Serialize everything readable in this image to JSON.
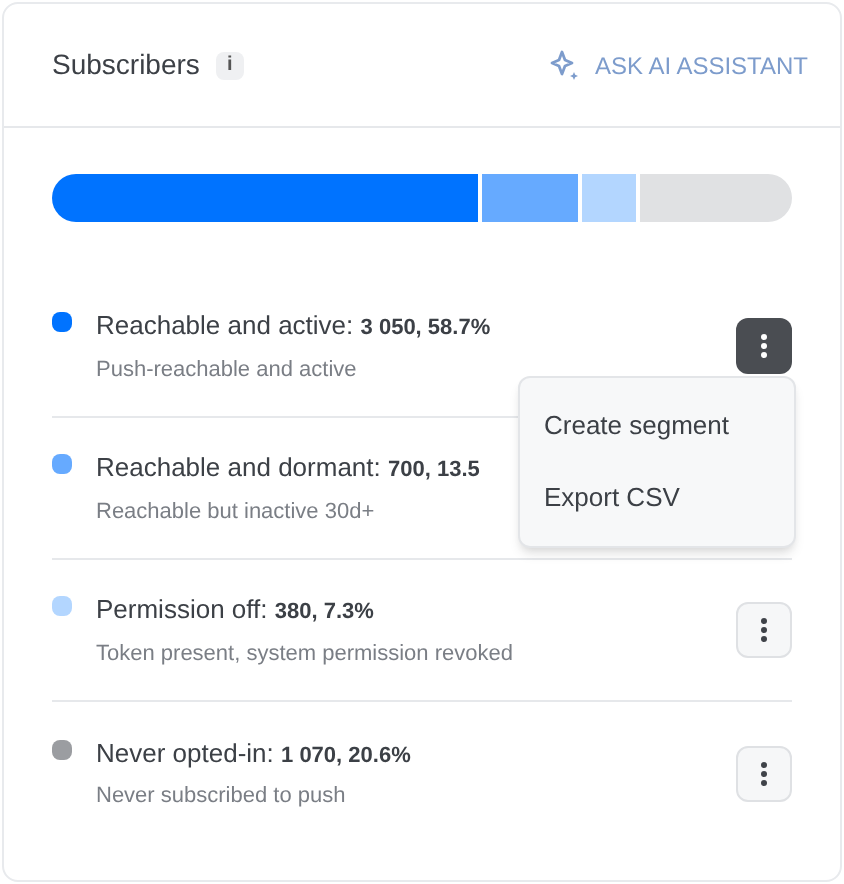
{
  "header": {
    "title": "Subscribers",
    "info_icon": "i",
    "assistant_button": "ASK AI ASSISTANT"
  },
  "bar": [
    {
      "color": "#0073ff"
    },
    {
      "color": "#66aaff"
    },
    {
      "color": "#b3d6ff"
    },
    {
      "color": "#e0e1e3"
    }
  ],
  "segments": [
    {
      "label": "Reachable and active:",
      "value": "3 050, 58.7%",
      "description": "Push-reachable and active",
      "color": "#0073ff",
      "menu_open": true,
      "menu_button_shown": true
    },
    {
      "label": "Reachable and dormant:",
      "value": "700, 13.5",
      "description": "Reachable but inactive 30d+",
      "color": "#66aaff",
      "menu_button_shown": false
    },
    {
      "label": "Permission off:",
      "value": "380, 7.3%",
      "description": "Token present, system permission revoked",
      "color": "#b3d6ff",
      "menu_open": false,
      "menu_button_shown": true
    },
    {
      "label": "Never opted-in:",
      "value": "1 070, 20.6%",
      "description": "Never subscribed to push",
      "color": "#9b9da1",
      "menu_open": false,
      "menu_button_shown": true
    }
  ],
  "menu": {
    "items": [
      "Create segment",
      "Export CSV"
    ]
  }
}
